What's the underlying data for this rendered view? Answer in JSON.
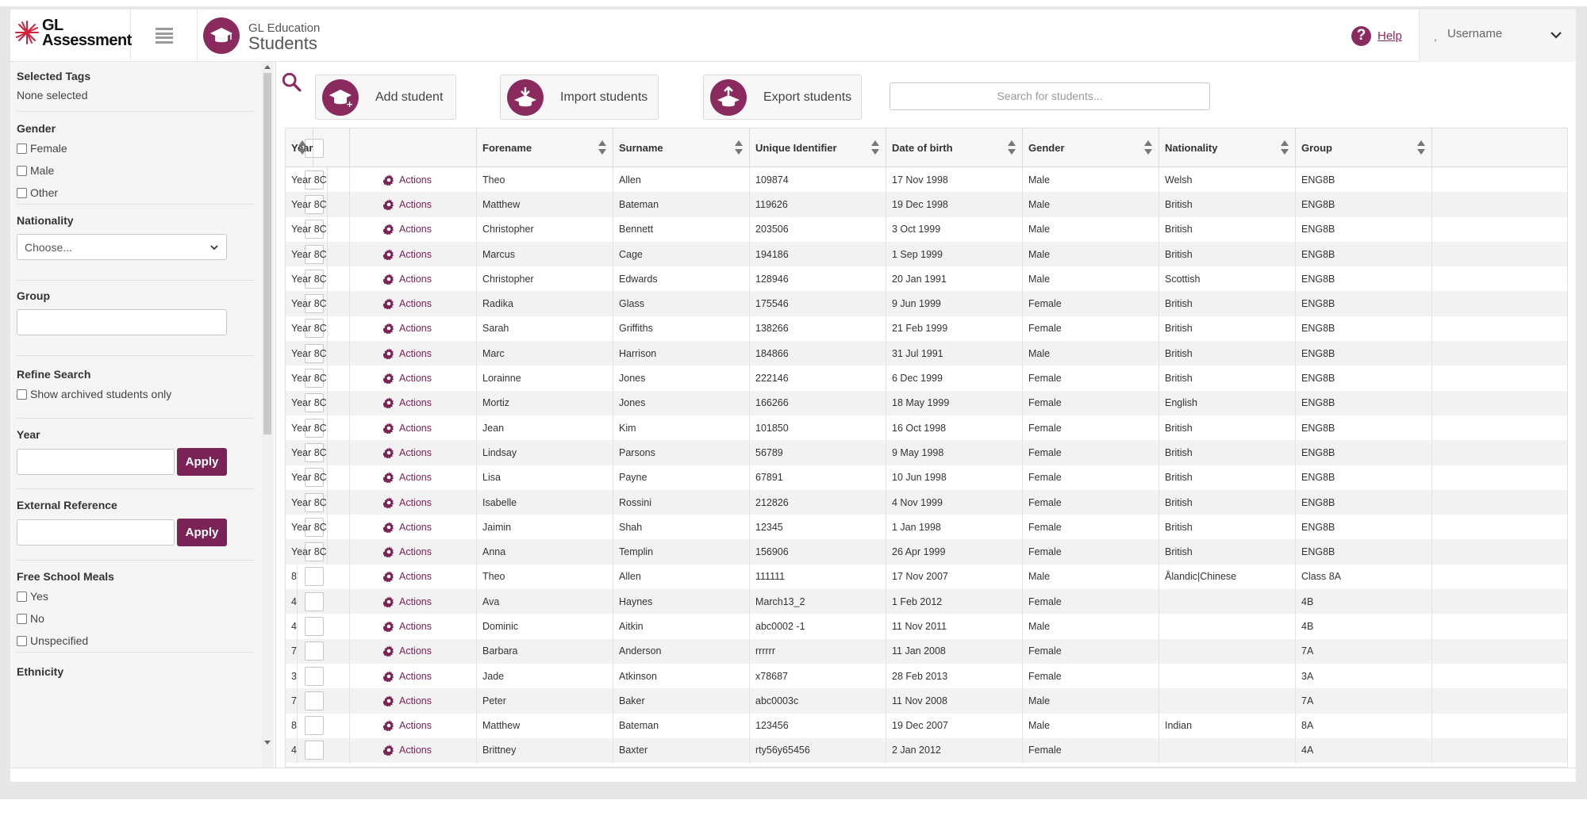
{
  "header": {
    "logo_line1": "GL",
    "logo_line2": "Assessment",
    "app_sub": "GL Education",
    "app_title": "Students",
    "help_label": "Help",
    "user_prefix": ",",
    "username": "Username"
  },
  "sidebar": {
    "selected_tags_title": "Selected Tags",
    "selected_tags_value": "None selected",
    "gender_title": "Gender",
    "gender_options": [
      "Female",
      "Male",
      "Other"
    ],
    "nationality_title": "Nationality",
    "nationality_value": "Choose...",
    "group_title": "Group",
    "refine_title": "Refine Search",
    "archived_label": "Show archived students only",
    "year_title": "Year",
    "apply_label": "Apply",
    "external_ref_title": "External Reference",
    "fsm_title": "Free School Meals",
    "fsm_options": [
      "Yes",
      "No",
      "Unspecified"
    ],
    "ethnicity_title": "Ethnicity"
  },
  "toolbar": {
    "add_label": "Add student",
    "import_label": "Import students",
    "export_label": "Export students",
    "search_placeholder": "Search for students..."
  },
  "table": {
    "action_label": "Actions",
    "columns": [
      "Forename",
      "Surname",
      "Unique Identifier",
      "Date of birth",
      "Gender",
      "Nationality",
      "Group",
      "Year"
    ],
    "rows": [
      [
        "Theo",
        "Allen",
        "109874",
        "17 Nov 1998",
        "Male",
        "Welsh",
        "ENG8B",
        "Year 8C"
      ],
      [
        "Matthew",
        "Bateman",
        "119626",
        "19 Dec 1998",
        "Male",
        "British",
        "ENG8B",
        "Year 8C"
      ],
      [
        "Christopher",
        "Bennett",
        "203506",
        "3 Oct 1999",
        "Male",
        "British",
        "ENG8B",
        "Year 8C"
      ],
      [
        "Marcus",
        "Cage",
        "194186",
        "1 Sep 1999",
        "Male",
        "British",
        "ENG8B",
        "Year 8C"
      ],
      [
        "Christopher",
        "Edwards",
        "128946",
        "20 Jan 1991",
        "Male",
        "Scottish",
        "ENG8B",
        "Year 8C"
      ],
      [
        "Radika",
        "Glass",
        "175546",
        "9 Jun 1999",
        "Female",
        "British",
        "ENG8B",
        "Year 8C"
      ],
      [
        "Sarah",
        "Griffiths",
        "138266",
        "21 Feb 1999",
        "Female",
        "British",
        "ENG8B",
        "Year 8C"
      ],
      [
        "Marc",
        "Harrison",
        "184866",
        "31 Jul 1991",
        "Male",
        "British",
        "ENG8B",
        "Year 8C"
      ],
      [
        "Lorainne",
        "Jones",
        "222146",
        "6 Dec 1999",
        "Female",
        "British",
        "ENG8B",
        "Year 8C"
      ],
      [
        "Mortiz",
        "Jones",
        "166266",
        "18 May 1999",
        "Female",
        "English",
        "ENG8B",
        "Year 8C"
      ],
      [
        "Jean",
        "Kim",
        "101850",
        "16 Oct 1998",
        "Female",
        "British",
        "ENG8B",
        "Year 8C"
      ],
      [
        "Lindsay",
        "Parsons",
        "56789",
        "9 May 1998",
        "Female",
        "British",
        "ENG8B",
        "Year 8C"
      ],
      [
        "Lisa",
        "Payne",
        "67891",
        "10 Jun 1998",
        "Female",
        "British",
        "ENG8B",
        "Year 8C"
      ],
      [
        "Isabelle",
        "Rossini",
        "212826",
        "4 Nov 1999",
        "Female",
        "British",
        "ENG8B",
        "Year 8C"
      ],
      [
        "Jaimin",
        "Shah",
        "12345",
        "1 Jan 1998",
        "Female",
        "British",
        "ENG8B",
        "Year 8C"
      ],
      [
        "Anna",
        "Templin",
        "156906",
        "26 Apr 1999",
        "Female",
        "British",
        "ENG8B",
        "Year 8C"
      ],
      [
        "Theo",
        "Allen",
        "111111",
        "17 Nov 2007",
        "Male",
        "Ålandic|Chinese",
        "Class 8A",
        "8"
      ],
      [
        "Ava",
        "Haynes",
        "March13_2",
        "1 Feb 2012",
        "Female",
        "",
        "4B",
        "4"
      ],
      [
        "Dominic",
        "Aitkin",
        "abc0002 -1",
        "11 Nov 2011",
        "Male",
        "",
        "4B",
        "4"
      ],
      [
        "Barbara",
        "Anderson",
        "rrrrrr",
        "11 Jan 2008",
        "Female",
        "",
        "7A",
        "7"
      ],
      [
        "Jade",
        "Atkinson",
        "x78687",
        "28 Feb 2013",
        "Female",
        "",
        "3A",
        "3"
      ],
      [
        "Peter",
        "Baker",
        "abc0003c",
        "11 Nov 2008",
        "Male",
        "",
        "7A",
        "7"
      ],
      [
        "Matthew",
        "Bateman",
        "123456",
        "19 Dec 2007",
        "Male",
        "Indian",
        "8A",
        "8"
      ],
      [
        "Brittney",
        "Baxter",
        "rty56y65456",
        "2 Jan 2012",
        "Female",
        "",
        "4A",
        "4"
      ]
    ]
  }
}
